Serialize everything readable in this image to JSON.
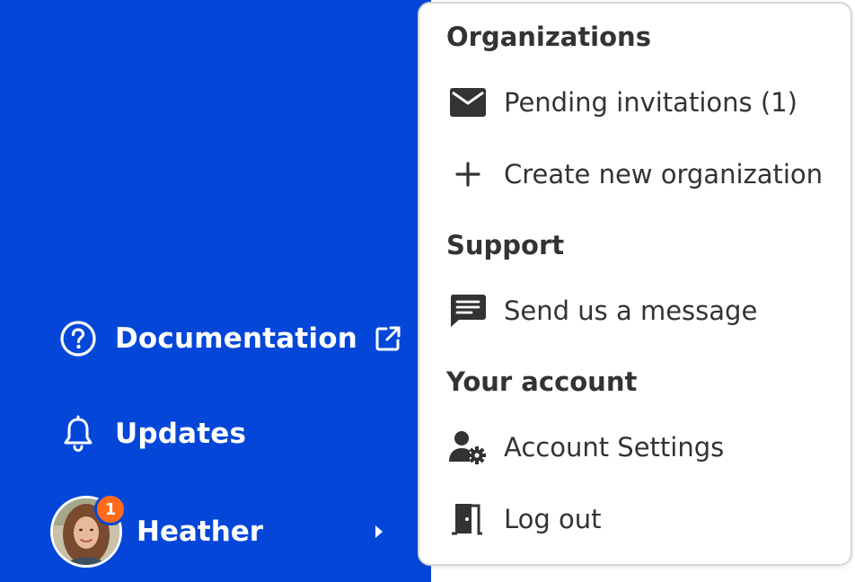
{
  "sidebar": {
    "documentation_label": "Documentation",
    "updates_label": "Updates",
    "user": {
      "name": "Heather",
      "notification_count": "1"
    }
  },
  "menu": {
    "organizations": {
      "title": "Organizations",
      "items": [
        {
          "label": "Pending invitations (1)",
          "icon": "mail-icon"
        },
        {
          "label": "Create new organization",
          "icon": "plus-icon"
        }
      ]
    },
    "support": {
      "title": "Support",
      "items": [
        {
          "label": "Send us a message",
          "icon": "chat-icon"
        }
      ]
    },
    "account": {
      "title": "Your account",
      "items": [
        {
          "label": "Account Settings",
          "icon": "user-settings-icon"
        },
        {
          "label": "Log out",
          "icon": "logout-door-icon"
        }
      ]
    }
  },
  "colors": {
    "sidebar_bg": "#0447d8",
    "badge": "#ff6a1a",
    "menu_text": "#333333"
  }
}
